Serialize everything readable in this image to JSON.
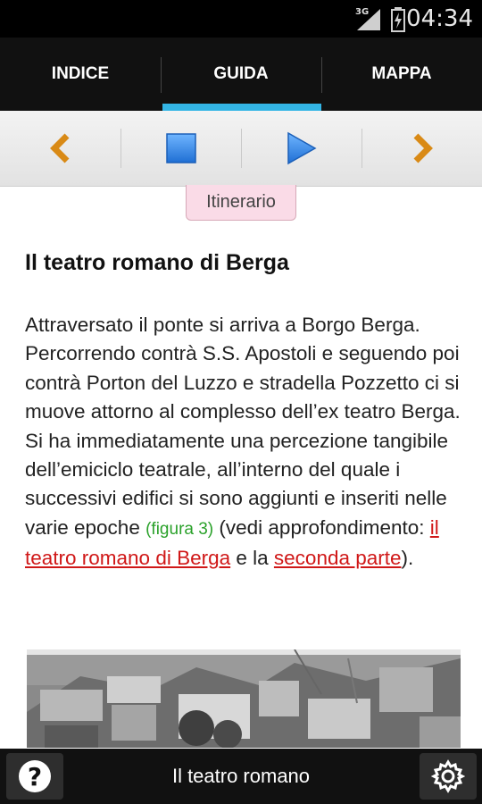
{
  "status_bar": {
    "network": "3G",
    "time": "04:34"
  },
  "tabs": [
    {
      "label": "INDICE",
      "selected": false
    },
    {
      "label": "GUIDA",
      "selected": true
    },
    {
      "label": "MAPPA",
      "selected": false
    }
  ],
  "toolbar": {
    "prev_icon": "chevron-left-icon",
    "stop_icon": "stop-icon",
    "play_icon": "play-icon",
    "next_icon": "chevron-right-icon"
  },
  "badge": "Itinerario",
  "article": {
    "title": "Il teatro romano di Berga",
    "text_1": "Attraversato il ponte si arriva a Borgo Berga. Percorrendo contrà S.S. Apostoli e seguendo poi contrà Porton del Luzzo e stradella Pozzetto ci si muove attorno al complesso dell’ex teatro Berga. Si ha immediatamente una percezione tangibile dell’emiciclo teatrale, all’interno del quale i successivi edifici si sono aggiunti e inseriti nelle varie epoche",
    "figure_ref": "(figura 3)",
    "text_2": " (vedi approfondimento: ",
    "link_1": "il teatro romano di Berga",
    "text_3": " e la ",
    "link_2": "seconda parte",
    "text_4": ")."
  },
  "bottom_bar": {
    "title": "Il teatro romano",
    "help_icon": "help-icon",
    "settings_icon": "gear-icon"
  },
  "colors": {
    "tab_indicator": "#33b5e5",
    "toolbar_chevron": "#d98a16",
    "toolbar_blue": "#3c8ee8",
    "link": "#d01818",
    "figure_ref": "#2aa12a",
    "badge_bg": "#fadbe7"
  }
}
